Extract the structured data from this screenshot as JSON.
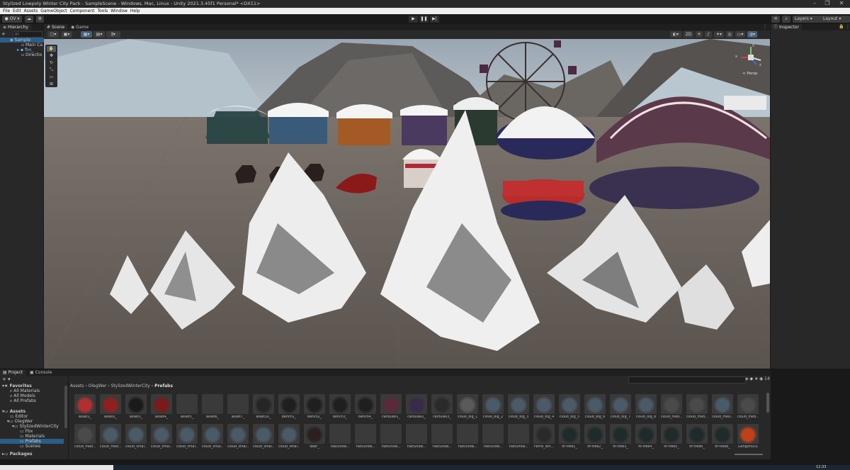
{
  "window": {
    "title": "Stylized Lowpoly Winter City Pack - SampleScene - Windows, Mac, Linux - Unity 2021.3.45f1 Personal* <DX11>"
  },
  "menu": [
    "File",
    "Edit",
    "Assets",
    "GameObject",
    "Component",
    "Tools",
    "Window",
    "Help"
  ],
  "toolbar": {
    "account": "OV",
    "layers_label": "Layers",
    "layout_label": "Layout"
  },
  "hierarchy": {
    "tab": "Hierarchy",
    "search_placeholder": "All",
    "items": [
      {
        "label": "Sample"
      },
      {
        "label": "Main Ca"
      },
      {
        "label": "fbx_"
      },
      {
        "label": "Directio"
      }
    ]
  },
  "scene_view": {
    "tabs": [
      "Scene",
      "Game"
    ],
    "mode_2d": "2D",
    "persp_label": "< Persp",
    "gizmo_axes": {
      "x": "x",
      "y": "y",
      "z": "z"
    }
  },
  "inspector": {
    "tab": "Inspector"
  },
  "project": {
    "tabs": [
      "Project",
      "Console"
    ],
    "count": "14",
    "favorites_label": "Favorites",
    "favorites": [
      "All Materials",
      "All Models",
      "All Prefabs"
    ],
    "assets_label": "Assets",
    "tree": [
      "Editor",
      "OlegWer",
      "StylizedWinterCity",
      "Fbx",
      "Materials",
      "Prefabs",
      "Scenes"
    ],
    "packages_label": "Packages",
    "breadcrumb": [
      "Assets",
      "OlegWer",
      "StylizedWinterCity",
      "Prefabs"
    ],
    "row1": [
      {
        "label": "asset1_",
        "color": "#b03030"
      },
      {
        "label": "asset2_",
        "color": "#902020"
      },
      {
        "label": "asset3_",
        "color": "#1a1a1a"
      },
      {
        "label": "asset4_",
        "color": "#7a1a1a"
      },
      {
        "label": "asset5_",
        "color": "#3a3a3a"
      },
      {
        "label": "asset6_",
        "color": "#3a3a3a"
      },
      {
        "label": "asset7_",
        "color": "#3a3a3a"
      },
      {
        "label": "asset10_",
        "color": "#252525"
      },
      {
        "label": "bench1_",
        "color": "#1f1f1f"
      },
      {
        "label": "bench2_",
        "color": "#1f1f1f"
      },
      {
        "label": "bench3_",
        "color": "#1f1f1f"
      },
      {
        "label": "bench4_",
        "color": "#1f1f1f"
      },
      {
        "label": "carousel1_",
        "color": "#5a2a3a"
      },
      {
        "label": "carousel2_",
        "color": "#3a2a4a"
      },
      {
        "label": "carousel3_",
        "color": "#2a2a2a"
      },
      {
        "label": "cloud_big_1",
        "color": "#5a5a5a"
      },
      {
        "label": "cloud_big_2",
        "color": "#4a5a66"
      },
      {
        "label": "cloud_big_3",
        "color": "#4a5a66"
      },
      {
        "label": "cloud_big_4",
        "color": "#4a5a66"
      },
      {
        "label": "cloud_big_5",
        "color": "#4a5a66"
      },
      {
        "label": "cloud_big_6",
        "color": "#4a5a66"
      },
      {
        "label": "cloud_big_7",
        "color": "#4a5a66"
      },
      {
        "label": "cloud_big_8",
        "color": "#4a5a66"
      },
      {
        "label": "cloud_med...",
        "color": "#4a4a4a"
      },
      {
        "label": "cloud_med...",
        "color": "#4a4a4a"
      },
      {
        "label": "cloud_med...",
        "color": "#4a5a66"
      },
      {
        "label": "cloud_med...",
        "color": "#4a4a4a"
      }
    ],
    "row2": [
      {
        "label": "cloud_med...",
        "color": "#4a4a4a"
      },
      {
        "label": "cloud_med...",
        "color": "#4a5a66"
      },
      {
        "label": "cloud_smal...",
        "color": "#4a5a66"
      },
      {
        "label": "cloud_smal...",
        "color": "#4a5a66"
      },
      {
        "label": "cloud_smal...",
        "color": "#4a5a66"
      },
      {
        "label": "cloud_smal...",
        "color": "#4a5a66"
      },
      {
        "label": "cloud_smal...",
        "color": "#4a5a66"
      },
      {
        "label": "cloud_smal...",
        "color": "#4a5a66"
      },
      {
        "label": "cloud_smal...",
        "color": "#4a5a66"
      },
      {
        "label": "deer_",
        "color": "#2a2020"
      },
      {
        "label": "FastSnow...",
        "color": "#3a3a3a"
      },
      {
        "label": "FastSnow...",
        "color": "#3a3a3a"
      },
      {
        "label": "FastSnow...",
        "color": "#3a3a3a"
      },
      {
        "label": "FastSnow...",
        "color": "#3a3a3a"
      },
      {
        "label": "FastSnow...",
        "color": "#3a3a3a"
      },
      {
        "label": "FastSnow...",
        "color": "#3a3a3a"
      },
      {
        "label": "FastSnow...",
        "color": "#3a3a3a"
      },
      {
        "label": "FastSnow...",
        "color": "#3a3a3a"
      },
      {
        "label": "Ferris_Wh...",
        "color": "#2a2a2a"
      },
      {
        "label": "fir-tree1_",
        "color": "#1f2a2a"
      },
      {
        "label": "fir-tree2_",
        "color": "#1f2a2a"
      },
      {
        "label": "fir-tree3_",
        "color": "#1f2a2a"
      },
      {
        "label": "fir-tree4_",
        "color": "#1f2a2a"
      },
      {
        "label": "fir-tree5_",
        "color": "#1f2a2a"
      },
      {
        "label": "fir-tree6_",
        "color": "#1f2a2a"
      },
      {
        "label": "fir-tree8_",
        "color": "#1f2a2a"
      },
      {
        "label": "Gengon001",
        "color": "#c0401a"
      }
    ]
  },
  "taskbar": {
    "clock": "12:33"
  }
}
